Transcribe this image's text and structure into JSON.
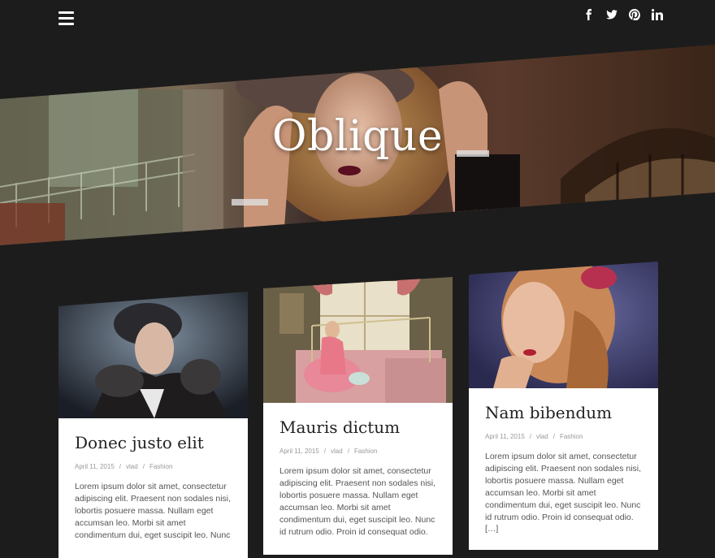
{
  "site": {
    "title": "Oblique"
  },
  "header": {
    "menu_icon": "hamburger-menu-icon",
    "social": [
      {
        "name": "facebook-icon"
      },
      {
        "name": "twitter-icon"
      },
      {
        "name": "pinterest-icon"
      },
      {
        "name": "linkedin-icon"
      }
    ]
  },
  "posts": [
    {
      "title": "Donec justo elit",
      "date": "April 11, 2015",
      "author": "vlad",
      "category": "Fashion",
      "sep": "/",
      "excerpt": "Lorem ipsum dolor sit amet, consectetur adipiscing elit. Praesent non sodales nisi, lobortis posuere massa. Nullam eget accumsan leo. Morbi sit amet condimentum dui, eget suscipit leo. Nunc",
      "more": ""
    },
    {
      "title": "Mauris dictum",
      "date": "April 11, 2015",
      "author": "vlad",
      "category": "Fashion",
      "sep": "/",
      "excerpt": "Lorem ipsum dolor sit amet, consectetur adipiscing elit. Praesent non sodales nisi, lobortis posuere massa. Nullam eget accumsan leo. Morbi sit amet condimentum dui, eget suscipit leo. Nunc id rutrum odio. Proin id consequat odio.",
      "more": ""
    },
    {
      "title": "Nam bibendum",
      "date": "April 11, 2015",
      "author": "vlad",
      "category": "Fashion",
      "sep": "/",
      "excerpt": "Lorem ipsum dolor sit amet, consectetur adipiscing elit. Praesent non sodales nisi, lobortis posuere massa. Nullam eget accumsan leo. Morbi sit amet condimentum dui, eget suscipit leo. Nunc id rutrum odio. Proin id consequat odio.",
      "more": "[…]"
    }
  ],
  "colors": {
    "background": "#1c1c1c",
    "card": "#ffffff",
    "heading": "#222222",
    "meta": "#999999"
  }
}
